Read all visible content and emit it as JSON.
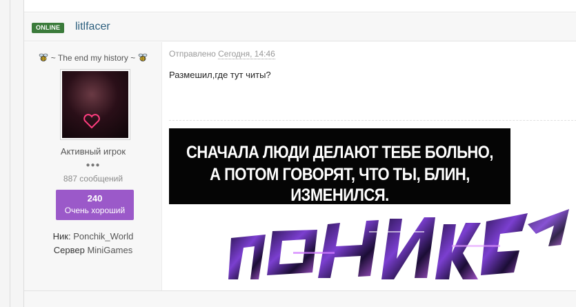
{
  "post": {
    "online_badge": "ONLINE",
    "username": "litlfacer",
    "user_title": "~ The end my history ~",
    "rank": "Активный игрок",
    "rank_pips": "●●●",
    "posts_count": "887 сообщений",
    "reputation": {
      "value": "240",
      "label": "Очень хороший"
    },
    "nick_label": "Ник:",
    "nick_value": "Ponchik_World",
    "server_label": "Сервер",
    "server_value": "MiniGames",
    "posted_label": "Отправлено",
    "posted_time": "Сегодня, 14:46",
    "text": "Размешил,где тут читы?",
    "quote_image": {
      "line1": "СНАЧАЛА ЛЮДИ ДЕЛАЮТ ТЕБЕ БОЛЬНО,",
      "line2": "А ПОТОМ ГОВОРЯТ, ЧТО ТЫ, БЛИН, ИЗМЕНИЛСЯ."
    },
    "signature_art": "ПОНЧИК"
  },
  "colors": {
    "online": "#3b7b3b",
    "username": "#2c5f7e",
    "reputation": "#9b59c9",
    "graffiti_primary": "#1a0f2e",
    "graffiti_accent": "#8a3fd1"
  },
  "icons": {
    "title_decoration": "bee-icon"
  }
}
